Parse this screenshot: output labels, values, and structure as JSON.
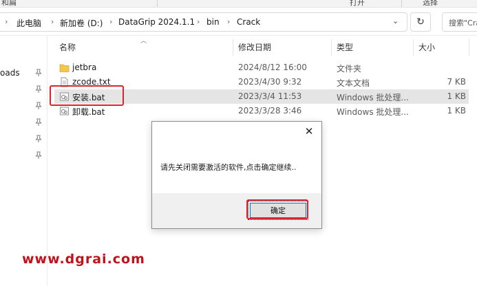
{
  "ribbon": {
    "items": [
      "和扁",
      "打开",
      "选择"
    ]
  },
  "address": {
    "crumbs": [
      "此电脑",
      "新加卷 (D:)",
      "DataGrip 2024.1.1",
      "bin",
      "Crack"
    ],
    "search_placeholder": "搜索\"Cra"
  },
  "nav": {
    "label": "oads",
    "pin_count": 6
  },
  "columns": {
    "name": "名称",
    "modified": "修改日期",
    "type": "类型",
    "size": "大小"
  },
  "files": [
    {
      "name": "jetbra",
      "modified": "2024/8/12 16:00",
      "type": "文件夹",
      "size": "",
      "icon": "folder-icon"
    },
    {
      "name": "zcode.txt",
      "modified": "2023/4/30 9:32",
      "type": "文本文档",
      "size": "7 KB",
      "icon": "text-file-icon"
    },
    {
      "name": "安装.bat",
      "modified": "2023/3/4 11:53",
      "type": "Windows 批处理...",
      "size": "1 KB",
      "icon": "bat-file-icon"
    },
    {
      "name": "卸载.bat",
      "modified": "2023/3/28 3:46",
      "type": "Windows 批处理...",
      "size": "1 KB",
      "icon": "bat-file-icon"
    }
  ],
  "dialog": {
    "message": "请先关闭需要激活的软件,点击确定继续..",
    "ok_label": "确定"
  },
  "watermark": "www.dgrai.com",
  "colors": {
    "highlight": "#e0202a",
    "selection": "#cce8ff",
    "folder": "#f4c74c",
    "watermark": "#c0121a"
  }
}
